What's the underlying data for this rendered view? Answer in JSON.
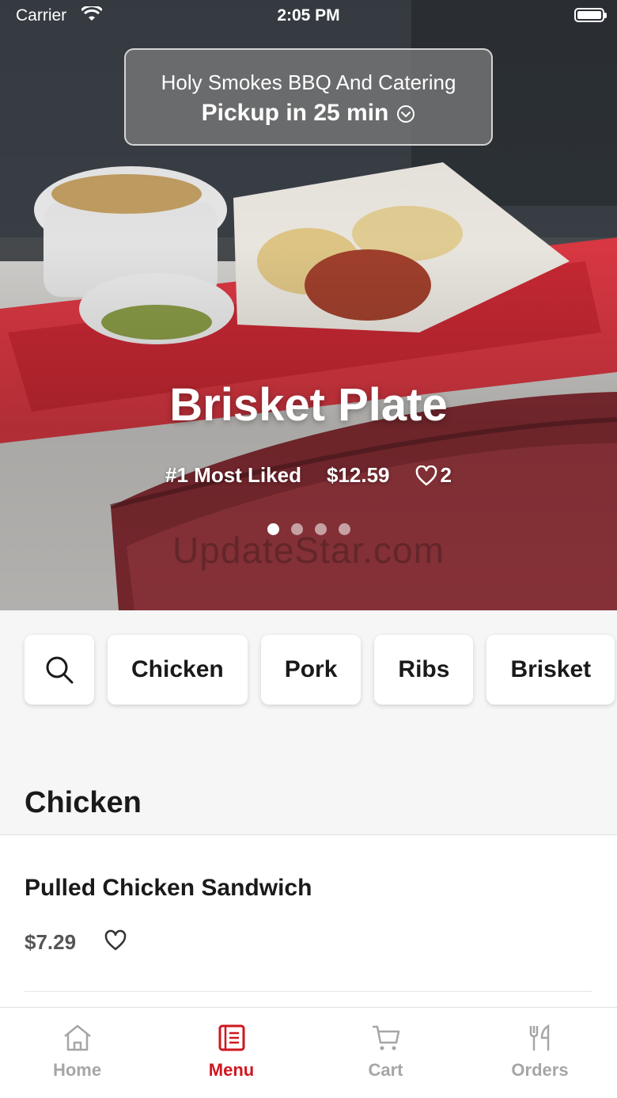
{
  "status_bar": {
    "carrier": "Carrier",
    "time": "2:05 PM"
  },
  "store": {
    "name": "Holy Smokes BBQ And Catering",
    "pickup": "Pickup in 25 min"
  },
  "featured": {
    "title": "Brisket Plate",
    "badge": "#1 Most Liked",
    "price": "$12.59",
    "likes": "2",
    "carousel_pages": 4,
    "carousel_active": 1,
    "watermark": "UpdateStar.com"
  },
  "categories": [
    "Chicken",
    "Pork",
    "Ribs",
    "Brisket"
  ],
  "section": {
    "title": "Chicken"
  },
  "items": [
    {
      "name": "Pulled Chicken Sandwich",
      "price": "$7.29"
    }
  ],
  "tabs": [
    {
      "label": "Home",
      "icon": "home-icon",
      "active": false
    },
    {
      "label": "Menu",
      "icon": "menu-icon",
      "active": true
    },
    {
      "label": "Cart",
      "icon": "cart-icon",
      "active": false
    },
    {
      "label": "Orders",
      "icon": "orders-icon",
      "active": false
    }
  ],
  "colors": {
    "accent": "#d0161f",
    "tab_inactive": "#a6a6a6"
  }
}
